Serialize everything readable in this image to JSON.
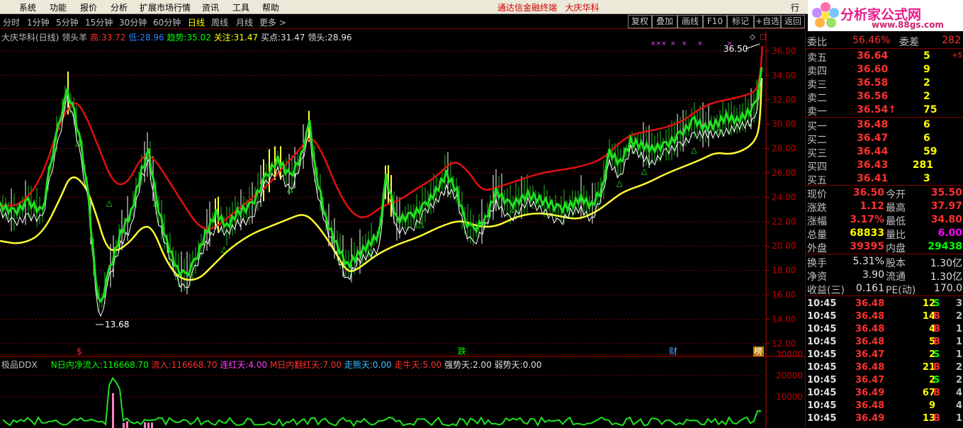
{
  "menu": [
    "系统",
    "功能",
    "报价",
    "分析",
    "扩展市场行情",
    "资讯",
    "工具",
    "帮助"
  ],
  "app_title": "通达信金融终端",
  "stock_name": "大庆华科",
  "top_right_stub": "行",
  "logo": {
    "brand": "分析家公式网",
    "url": "www.88gs.com"
  },
  "periods": [
    "分时",
    "1分钟",
    "5分钟",
    "15分钟",
    "30分钟",
    "60分钟",
    "日线",
    "周线",
    "月线",
    "更多 >"
  ],
  "active_period": "日线",
  "toolbar_buttons": [
    "复权",
    "叠加",
    "画线",
    "F10",
    "标记",
    "+自选",
    "返回"
  ],
  "info": {
    "title": "大庆华科(日线) 领头羊",
    "high_label": "高:",
    "high": "33.72",
    "low_label": "低:",
    "low": "28.96",
    "trend_label": "趋势:",
    "trend": "35.02",
    "focus_label": "关注:",
    "focus": "31.47",
    "buy_label": "买点:",
    "buy": "31.47",
    "lead_label": "领头:",
    "lead": "28.96"
  },
  "price_axis": [
    "36.00",
    "34.00",
    "32.00",
    "30.00",
    "28.00",
    "26.00",
    "24.00",
    "22.00",
    "20.00",
    "18.00",
    "16.00",
    "14.00",
    "12.00"
  ],
  "annotations": {
    "high_marker": "36.50",
    "low_marker": "13.68"
  },
  "bottom_markers": [
    "$",
    "跌",
    "财",
    "榜"
  ],
  "ddx": {
    "name": "极品DDX",
    "n_flow_label": "N日内净流入:",
    "n_flow": "116668.70",
    "flow_label": "流入:",
    "flow": "116668.70",
    "red_days_label": "连红天:",
    "red_days": "4.00",
    "m_red_label": "M日内翻红天:",
    "m_red": "7.00",
    "walk_label": "走熊天:",
    "walk": "0.00",
    "bull_label": "走牛天:",
    "bull": "5.00",
    "strong_label": "强势天:",
    "strong": "2.00",
    "weak_label": "弱势天:",
    "weak": "0.00"
  },
  "ddx_axis": [
    "30000",
    "20000",
    "10000"
  ],
  "quote": {
    "ratio_label": "委比",
    "ratio": "56.46%",
    "diff_label": "委差",
    "diff": "282",
    "asks": [
      {
        "label": "卖五",
        "price": "36.64",
        "vol": "5",
        "chg": "+5"
      },
      {
        "label": "卖四",
        "price": "36.60",
        "vol": "9",
        "chg": ""
      },
      {
        "label": "卖三",
        "price": "36.58",
        "vol": "2",
        "chg": ""
      },
      {
        "label": "卖二",
        "price": "36.56",
        "vol": "2",
        "chg": ""
      },
      {
        "label": "卖一",
        "price": "36.54↑",
        "vol": "75",
        "chg": ""
      }
    ],
    "bids": [
      {
        "label": "买一",
        "price": "36.48",
        "vol": "6"
      },
      {
        "label": "买二",
        "price": "36.47",
        "vol": "6"
      },
      {
        "label": "买三",
        "price": "36.44",
        "vol": "59"
      },
      {
        "label": "买四",
        "price": "36.43",
        "vol": "281"
      },
      {
        "label": "买五",
        "price": "36.41",
        "vol": "3"
      }
    ],
    "stats": [
      {
        "l1": "现价",
        "v1": "36.50",
        "c1": "#ff3030",
        "l2": "今开",
        "v2": "35.50",
        "c2": "#ff3030"
      },
      {
        "l1": "涨跌",
        "v1": "1.12",
        "c1": "#ff3030",
        "l2": "最高",
        "v2": "37.97",
        "c2": "#ff3030"
      },
      {
        "l1": "涨幅",
        "v1": "3.17%",
        "c1": "#ff3030",
        "l2": "最低",
        "v2": "34.80",
        "c2": "#ff3030"
      },
      {
        "l1": "总量",
        "v1": "68833",
        "c1": "#ffff00",
        "l2": "量比",
        "v2": "6.00",
        "c2": "#ff00ff"
      },
      {
        "l1": "外盘",
        "v1": "39395",
        "c1": "#ff3030",
        "l2": "内盘",
        "v2": "29438",
        "c2": "#00ff00"
      }
    ],
    "fundamentals": [
      {
        "l1": "换手",
        "v1": "5.31%",
        "l2": "股本",
        "v2": "1.30亿"
      },
      {
        "l1": "净资",
        "v1": "3.90",
        "l2": "流通",
        "v2": "1.30亿"
      },
      {
        "l1": "收益(三)",
        "v1": "0.161",
        "l2": "PE(动)",
        "v2": "170.0"
      }
    ],
    "ticks": [
      {
        "t": "10:45",
        "p": "36.48",
        "v": "12",
        "s": "S",
        "n": "3"
      },
      {
        "t": "10:45",
        "p": "36.48",
        "v": "14",
        "s": "B",
        "n": "2"
      },
      {
        "t": "10:45",
        "p": "36.48",
        "v": "4",
        "s": "B",
        "n": "1"
      },
      {
        "t": "10:45",
        "p": "36.48",
        "v": "5",
        "s": "B",
        "n": "1"
      },
      {
        "t": "10:45",
        "p": "36.47",
        "v": "2",
        "s": "S",
        "n": "1"
      },
      {
        "t": "10:45",
        "p": "36.48",
        "v": "21",
        "s": "B",
        "n": "2"
      },
      {
        "t": "10:45",
        "p": "36.47",
        "v": "2",
        "s": "S",
        "n": "2"
      },
      {
        "t": "10:45",
        "p": "36.49",
        "v": "67",
        "s": "B",
        "n": "4"
      },
      {
        "t": "10:45",
        "p": "36.48",
        "v": "9",
        "s": "",
        "n": "4"
      },
      {
        "t": "10:45",
        "p": "36.49",
        "v": "13",
        "s": "B",
        "n": "1"
      }
    ]
  }
}
